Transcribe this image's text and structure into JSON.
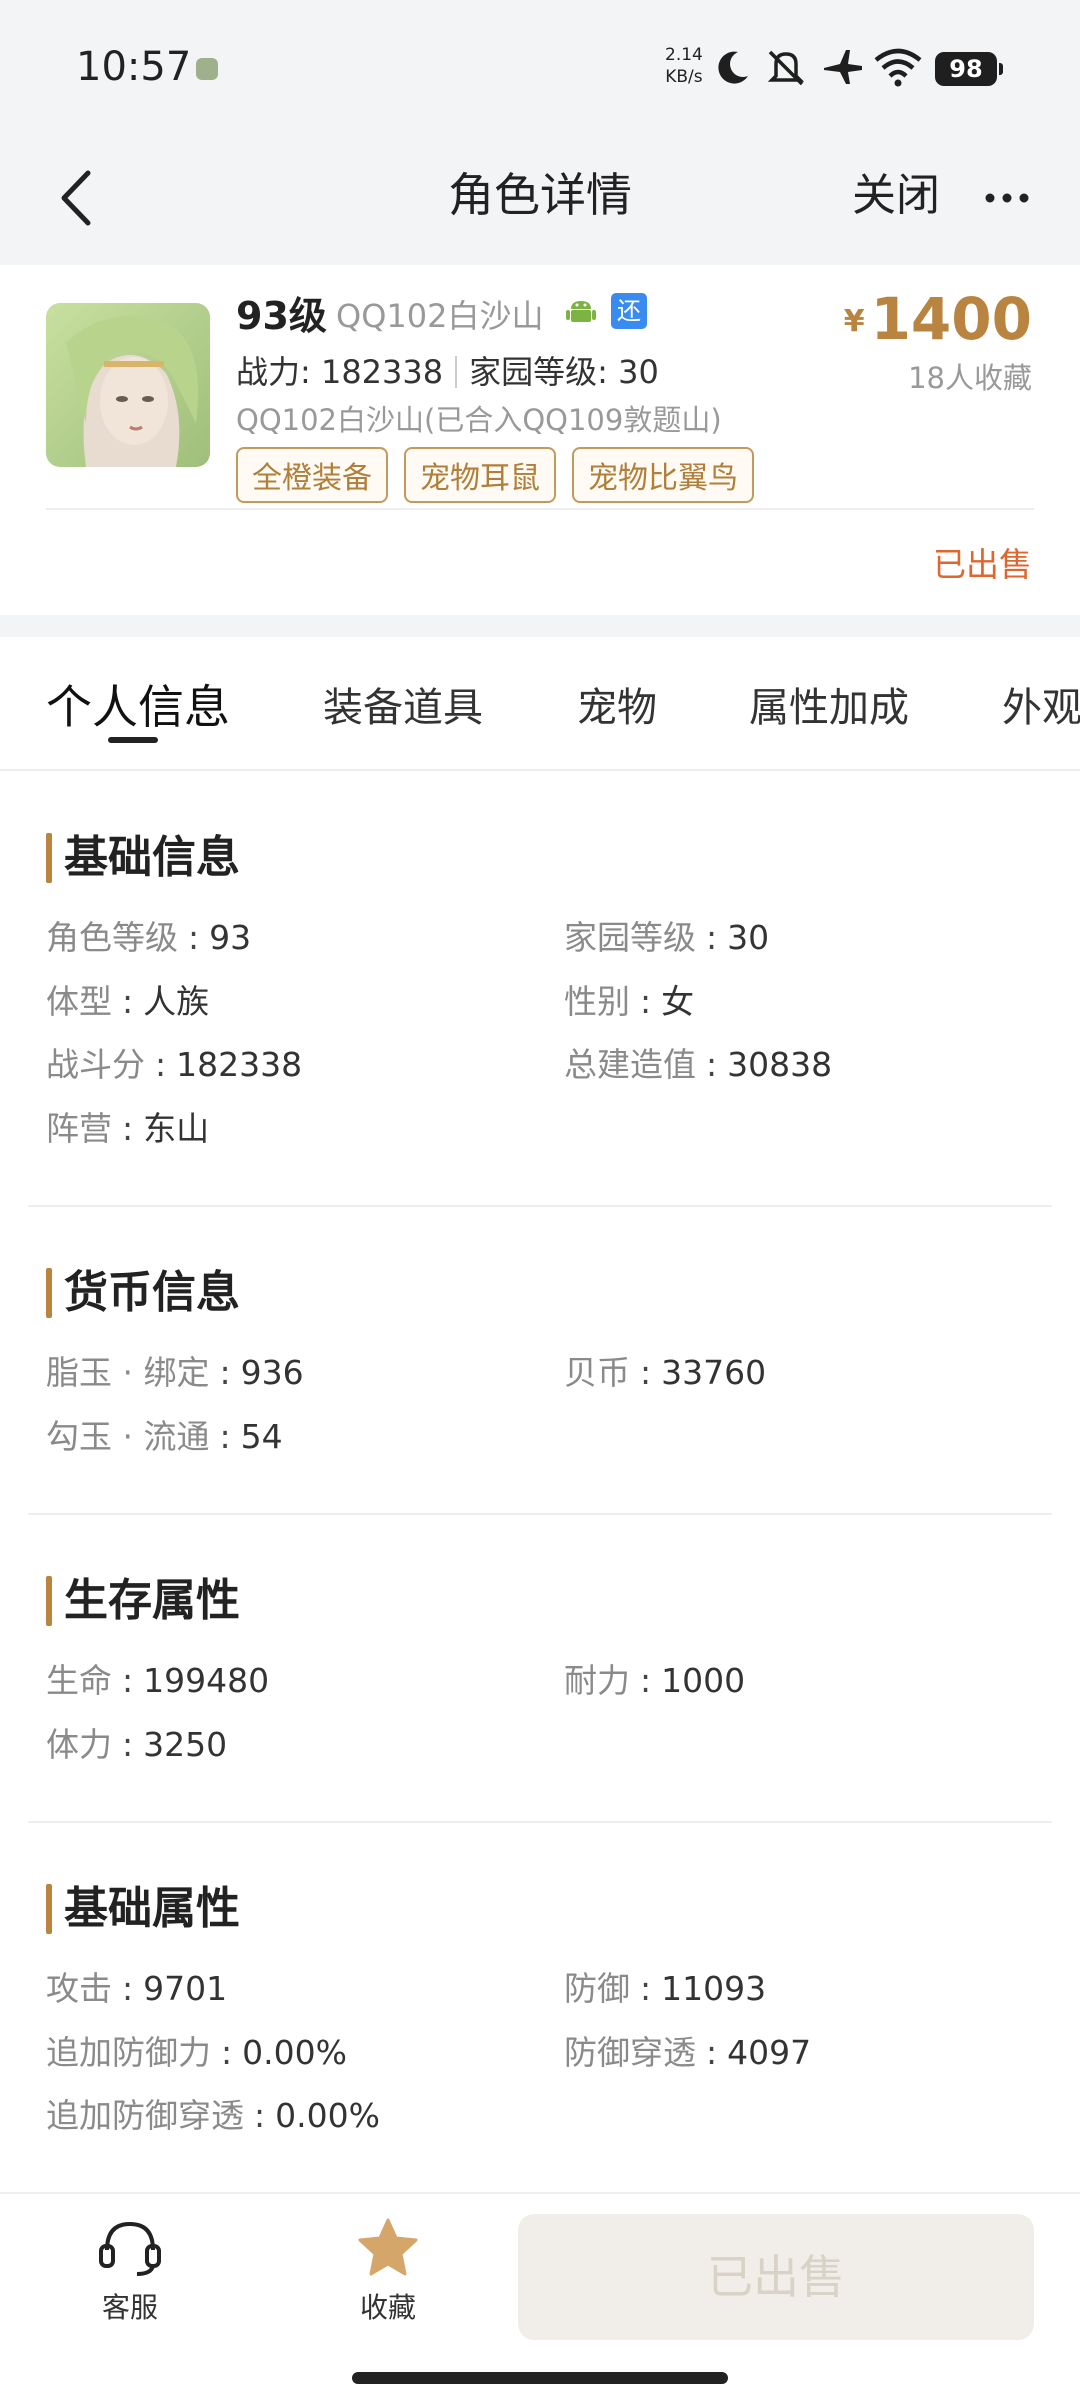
{
  "status_bar": {
    "time": "10:57",
    "net_speed_value": "2.14",
    "net_speed_unit": "KB/s",
    "battery": "98",
    "icons": [
      "moon-icon",
      "mute-icon",
      "airplane-icon",
      "wifi-icon"
    ]
  },
  "nav": {
    "title": "角色详情",
    "close": "关闭"
  },
  "summary": {
    "level": "93级",
    "server": "QQ102白沙山",
    "return_badge": "还",
    "power_label": "战力: 182338",
    "home_level_label": "家园等级: 30",
    "merged_server": "QQ102白沙山(已合入QQ109敦题山)",
    "tags": [
      "全橙装备",
      "宠物耳鼠",
      "宠物比翼鸟"
    ],
    "currency": "¥",
    "price": "1400",
    "favorites": "18人收藏",
    "status": "已出售",
    "accent_color": "#b8843f",
    "sold_color": "#e0662f"
  },
  "tabs": [
    "个人信息",
    "装备道具",
    "宠物",
    "属性加成",
    "外观"
  ],
  "active_tab": "个人信息",
  "sections": {
    "basic_info": {
      "title": "基础信息",
      "items": [
        {
          "k": "角色等级",
          "v": "93"
        },
        {
          "k": "家园等级",
          "v": "30"
        },
        {
          "k": "体型",
          "v": "人族"
        },
        {
          "k": "性别",
          "v": "女"
        },
        {
          "k": "战斗分",
          "v": "182338"
        },
        {
          "k": "总建造值",
          "v": "30838"
        },
        {
          "k": "阵营",
          "v": "东山"
        }
      ]
    },
    "currency_info": {
      "title": "货币信息",
      "items": [
        {
          "k": "脂玉 · 绑定",
          "v": "936"
        },
        {
          "k": "贝币",
          "v": "33760"
        },
        {
          "k": "勾玉 · 流通",
          "v": "54"
        }
      ]
    },
    "survival": {
      "title": "生存属性",
      "items": [
        {
          "k": "生命",
          "v": "199480"
        },
        {
          "k": "耐力",
          "v": "1000"
        },
        {
          "k": "体力",
          "v": "3250"
        }
      ]
    },
    "base_attrs": {
      "title": "基础属性",
      "items": [
        {
          "k": "攻击",
          "v": "9701"
        },
        {
          "k": "防御",
          "v": "11093"
        },
        {
          "k": "追加防御力",
          "v": "0.00%"
        },
        {
          "k": "防御穿透",
          "v": "4097"
        },
        {
          "k": "追加防御穿透",
          "v": "0.00%"
        }
      ]
    }
  },
  "bottom_bar": {
    "service": "客服",
    "favorite": "收藏",
    "sold_button": "已出售"
  }
}
